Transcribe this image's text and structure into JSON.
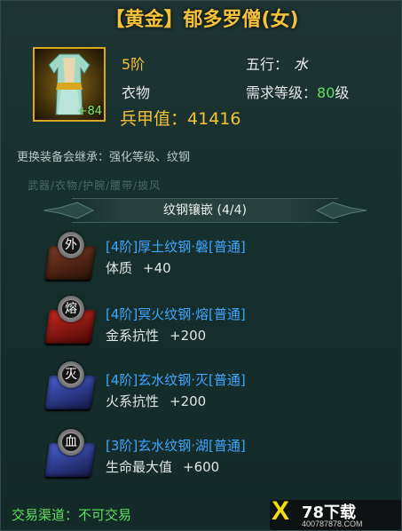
{
  "title": "【黄金】郁多罗僧(女)",
  "item": {
    "plus": "+84",
    "tier": "5阶",
    "type": "衣物",
    "element_label": "五行：",
    "element_value": "水",
    "level_label": "需求等级：",
    "level_value": "80",
    "level_unit": "级",
    "power_label": "兵甲值：",
    "power_value": "41416"
  },
  "inherit_note": "更换装备会继承：强化等级、纹钢",
  "faded_tabs": "武器/衣物/护腕/腰带/披风",
  "section_title": "纹钢镶嵌 (4/4)",
  "gems": [
    {
      "glyph": "外",
      "name": "[4阶]厚土纹钢·磐[普通]",
      "stat": "体质",
      "value": "+40"
    },
    {
      "glyph": "熔",
      "name": "[4阶]冥火纹钢·熔[普通]",
      "stat": "金系抗性",
      "value": "+200"
    },
    {
      "glyph": "灭",
      "name": "[4阶]玄水纹钢·灭[普通]",
      "stat": "火系抗性",
      "value": "+200"
    },
    {
      "glyph": "血",
      "name": "[3阶]玄水纹钢·湖[普通]",
      "stat": "生命最大值",
      "value": "+600"
    }
  ],
  "footer": "交易渠道：不可交易",
  "watermark": {
    "brand": "78下载",
    "site": "400787878.COM"
  },
  "colors": {
    "gold": "#f4c23a",
    "green": "#5fe05f",
    "blue": "#3fa6ff"
  }
}
